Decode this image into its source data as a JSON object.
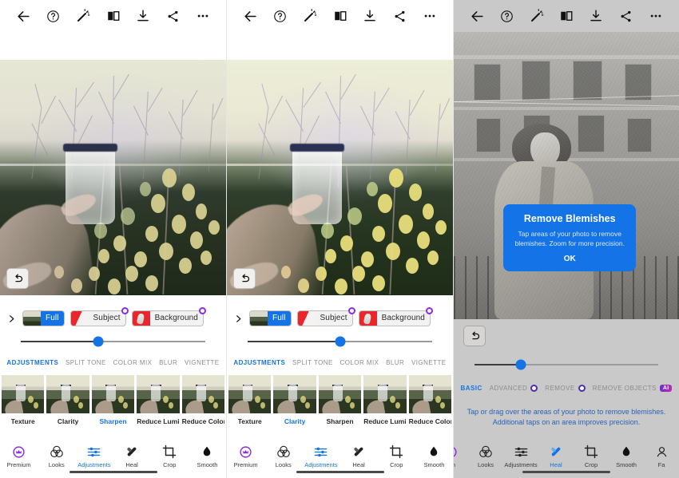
{
  "app": {
    "accent_blue": "#1473e6",
    "ai_purple": "#8a2be2",
    "toolbar_gray": "#c9c9c9"
  },
  "toolbar": {
    "back_label": "Back",
    "help_label": "Help",
    "magic_label": "Auto Enhance",
    "compare_label": "Compare Before/After",
    "save_label": "Save / Export",
    "share_label": "Share",
    "more_label": "More options",
    "icons": [
      "arrow-left-icon",
      "help-circle-icon",
      "magic-wand-icon",
      "compare-split-icon",
      "download-icon",
      "share-icon",
      "more-dots-icon"
    ]
  },
  "panel1": {
    "masks": {
      "expand_label": "Expand masks",
      "chips": [
        {
          "label": "Full",
          "selected": true,
          "ai_badge": false,
          "thumb": "garden-thumb"
        },
        {
          "label": "Subject",
          "selected": false,
          "ai_badge": true,
          "thumb": "subject-mask-thumb"
        },
        {
          "label": "Background",
          "selected": false,
          "ai_badge": true,
          "thumb": "background-mask-thumb"
        }
      ]
    },
    "slider": {
      "value_percent": 42
    },
    "tabs": [
      {
        "label": "ADJUSTMENTS",
        "active": true,
        "badge": "none"
      },
      {
        "label": "SPLIT TONE",
        "active": false,
        "badge": "none"
      },
      {
        "label": "COLOR MIX",
        "active": false,
        "badge": "none"
      },
      {
        "label": "BLUR",
        "active": false,
        "badge": "none"
      },
      {
        "label": "VIGNETTE",
        "active": false,
        "badge": "none"
      }
    ],
    "filters": [
      {
        "label": "Texture",
        "active": false
      },
      {
        "label": "Clarity",
        "active": false
      },
      {
        "label": "Sharpen",
        "active": true
      },
      {
        "label": "Reduce Lumin..",
        "active": false
      },
      {
        "label": "Reduce Color..",
        "active": false
      }
    ],
    "undo_label": "Undo",
    "nav": [
      {
        "label": "Premium",
        "icon": "premium-crown-icon",
        "active": false
      },
      {
        "label": "Looks",
        "icon": "looks-circles-icon",
        "active": false
      },
      {
        "label": "Adjustments",
        "icon": "sliders-icon",
        "active": true
      },
      {
        "label": "Heal",
        "icon": "bandage-icon",
        "active": false
      },
      {
        "label": "Crop",
        "icon": "crop-icon",
        "active": false
      },
      {
        "label": "Smooth",
        "icon": "droplet-icon",
        "active": false
      }
    ]
  },
  "panel2": {
    "masks": {
      "expand_label": "Expand masks",
      "chips": [
        {
          "label": "Full",
          "selected": true,
          "ai_badge": false,
          "thumb": "garden-thumb"
        },
        {
          "label": "Subject",
          "selected": false,
          "ai_badge": true,
          "thumb": "subject-mask-thumb"
        },
        {
          "label": "Background",
          "selected": false,
          "ai_badge": true,
          "thumb": "background-mask-thumb"
        }
      ]
    },
    "slider": {
      "value_percent": 50
    },
    "tabs": [
      {
        "label": "ADJUSTMENTS",
        "active": true,
        "badge": "none"
      },
      {
        "label": "SPLIT TONE",
        "active": false,
        "badge": "none"
      },
      {
        "label": "COLOR MIX",
        "active": false,
        "badge": "none"
      },
      {
        "label": "BLUR",
        "active": false,
        "badge": "none"
      },
      {
        "label": "VIGNETTE",
        "active": false,
        "badge": "none"
      }
    ],
    "filters": [
      {
        "label": "Texture",
        "active": false
      },
      {
        "label": "Clarity",
        "active": true
      },
      {
        "label": "Sharpen",
        "active": false
      },
      {
        "label": "Reduce Lumin..",
        "active": false
      },
      {
        "label": "Reduce Color..",
        "active": false
      }
    ],
    "undo_label": "Undo",
    "nav": [
      {
        "label": "Premium",
        "icon": "premium-crown-icon",
        "active": false
      },
      {
        "label": "Looks",
        "icon": "looks-circles-icon",
        "active": false
      },
      {
        "label": "Adjustments",
        "icon": "sliders-icon",
        "active": true
      },
      {
        "label": "Heal",
        "icon": "bandage-icon",
        "active": false
      },
      {
        "label": "Crop",
        "icon": "crop-icon",
        "active": false
      },
      {
        "label": "Smooth",
        "icon": "droplet-icon",
        "active": false
      }
    ]
  },
  "panel3": {
    "dialog": {
      "title": "Remove Blemishes",
      "body": "Tap areas of your photo to remove blemishes. Zoom for more precision.",
      "ok_label": "OK"
    },
    "undo_label": "Undo",
    "slider": {
      "value_percent": 25
    },
    "tabs": [
      {
        "label": "BASIC",
        "active": true,
        "badge": "none"
      },
      {
        "label": "ADVANCED",
        "active": false,
        "badge": "dot"
      },
      {
        "label": "REMOVE",
        "active": false,
        "badge": "dot"
      },
      {
        "label": "REMOVE OBJECTS",
        "active": false,
        "badge": "ai"
      }
    ],
    "badge_ai_label": "AI",
    "helper_text_line1": "Tap or drag over the areas of your photo to remove blemishes.",
    "helper_text_line2": "Additional taps on an area improves precision.",
    "nav": [
      {
        "label": "ium",
        "icon": "premium-crown-icon",
        "active": false
      },
      {
        "label": "Looks",
        "icon": "looks-circles-icon",
        "active": false
      },
      {
        "label": "Adjustments",
        "icon": "sliders-icon",
        "active": false
      },
      {
        "label": "Heal",
        "icon": "bandage-icon",
        "active": true
      },
      {
        "label": "Crop",
        "icon": "crop-icon",
        "active": false
      },
      {
        "label": "Smooth",
        "icon": "droplet-icon",
        "active": false
      },
      {
        "label": "Fa",
        "icon": "face-icon",
        "active": false
      }
    ]
  }
}
